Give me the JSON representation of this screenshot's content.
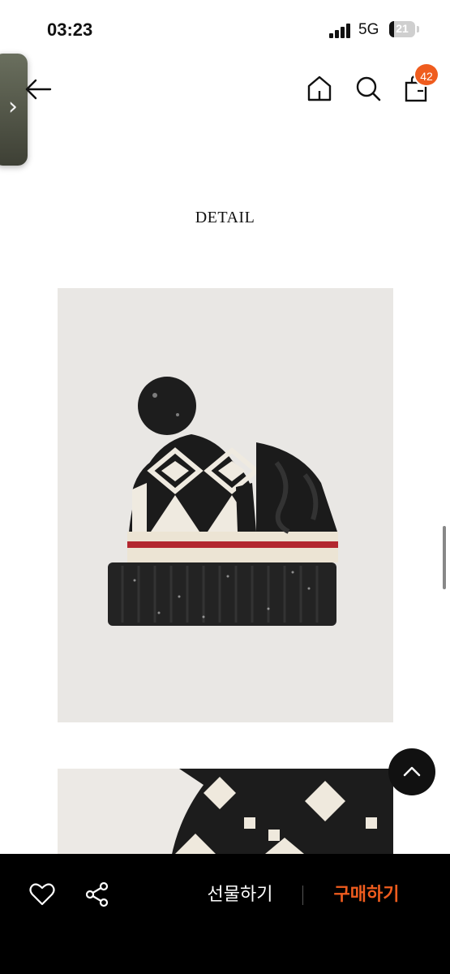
{
  "status_bar": {
    "time": "03:23",
    "network": "5G",
    "battery": "21"
  },
  "header": {
    "cart_count": "42"
  },
  "section": {
    "title": "DETAIL"
  },
  "bottom_bar": {
    "gift_label": "선물하기",
    "buy_label": "구매하기"
  },
  "colors": {
    "accent": "#ef5c1e",
    "bottom_bar_bg": "#000000",
    "image_bg": "#e9e7e4"
  },
  "icons": [
    "chevron-right-icon",
    "back-arrow-icon",
    "home-icon",
    "search-icon",
    "cart-icon",
    "chevron-up-icon",
    "heart-icon",
    "share-icon"
  ]
}
